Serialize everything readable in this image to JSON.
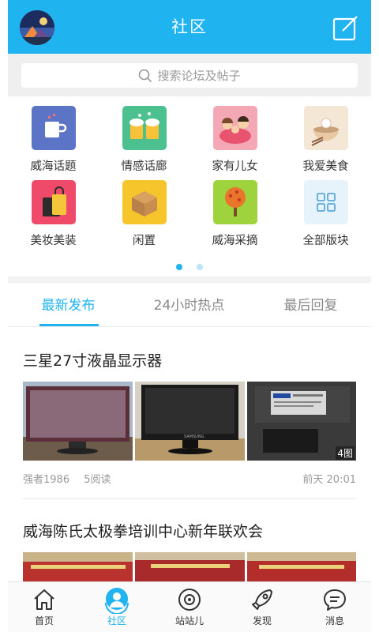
{
  "header": {
    "title": "社区",
    "avatar_icon": "avatar",
    "compose_icon": "compose-icon"
  },
  "search": {
    "placeholder": "搜索论坛及帖子",
    "icon": "search-icon"
  },
  "categories": [
    {
      "label": "威海话题",
      "icon": "cup-icon",
      "color": "#5b74c6"
    },
    {
      "label": "情感话廊",
      "icon": "beer-icon",
      "color": "#4cc08f"
    },
    {
      "label": "家有儿女",
      "icon": "family-icon",
      "color": "#f4a8b6"
    },
    {
      "label": "我爱美食",
      "icon": "food-icon",
      "color": "#f5e7d6"
    },
    {
      "label": "美妆美装",
      "icon": "bag-icon",
      "color": "#ef4a6a"
    },
    {
      "label": "闲置",
      "icon": "box-icon",
      "color": "#f5c52b"
    },
    {
      "label": "威海采摘",
      "icon": "tree-icon",
      "color": "#9fd33e"
    },
    {
      "label": "全部版块",
      "icon": "grid-icon",
      "color": "#e7f3fb"
    }
  ],
  "pager": {
    "pages": 2,
    "current": 1,
    "active_color": "#1fb3f0",
    "inactive_color": "#bfe4f7"
  },
  "tabs": [
    {
      "label": "最新发布",
      "active": true
    },
    {
      "label": "24小时热点",
      "active": false
    },
    {
      "label": "最后回复",
      "active": false
    }
  ],
  "posts": [
    {
      "title": "三星27寸液晶显示器",
      "image_count": "4图",
      "author": "强者1986",
      "reads": "5阅读",
      "time": "前天 20:01"
    },
    {
      "title": "威海陈氏太极拳培训中心新年联欢会"
    }
  ],
  "nav": [
    {
      "label": "首页",
      "icon": "home-icon",
      "active": false
    },
    {
      "label": "社区",
      "icon": "community-icon",
      "active": true
    },
    {
      "label": "站站儿",
      "icon": "station-icon",
      "active": false
    },
    {
      "label": "发现",
      "icon": "rocket-icon",
      "active": false
    },
    {
      "label": "消息",
      "icon": "message-icon",
      "active": false
    }
  ],
  "colors": {
    "brand": "#1fb3f0",
    "background": "#ffffff",
    "separator": "#f2f2f2"
  }
}
